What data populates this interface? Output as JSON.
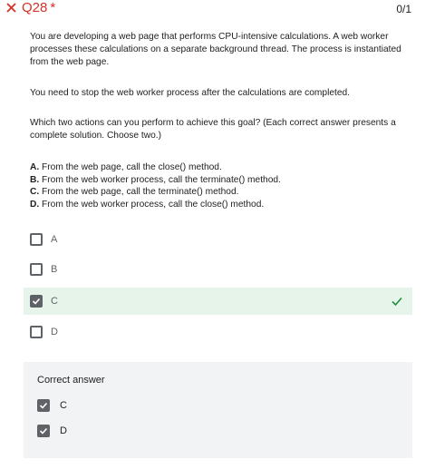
{
  "header": {
    "question_number": "Q28",
    "required_marker": "*",
    "score": "0/1",
    "status_icon": "close-icon",
    "status_color": "#d93025"
  },
  "question": {
    "paragraph1": "You are developing a web page that performs CPU-intensive calculations. A web worker processes these calculations on a separate background thread. The process is instantiated from the web page.",
    "paragraph2": "You need to stop the web worker process after the calculations are completed.",
    "paragraph3": "Which two actions can you perform to achieve this goal? (Each correct answer presents a complete solution. Choose two.)",
    "options": [
      {
        "letter": "A.",
        "text": "From the web page, call the close() method."
      },
      {
        "letter": "B.",
        "text": "From the web worker process, call the terminate() method."
      },
      {
        "letter": "C.",
        "text": "From the web page, call the terminate() method."
      },
      {
        "letter": "D.",
        "text": "From the web worker process, call the close() method."
      }
    ]
  },
  "choices": [
    {
      "label": "A",
      "checked": false
    },
    {
      "label": "B",
      "checked": false
    },
    {
      "label": "C",
      "checked": true,
      "correct": true
    },
    {
      "label": "D",
      "checked": false
    }
  ],
  "correct_answer": {
    "title": "Correct answer",
    "items": [
      "C",
      "D"
    ]
  },
  "colors": {
    "selected_bg": "#e6f4ea",
    "correct_check": "#1e8e3e",
    "panel_bg": "#f1f3f4"
  }
}
